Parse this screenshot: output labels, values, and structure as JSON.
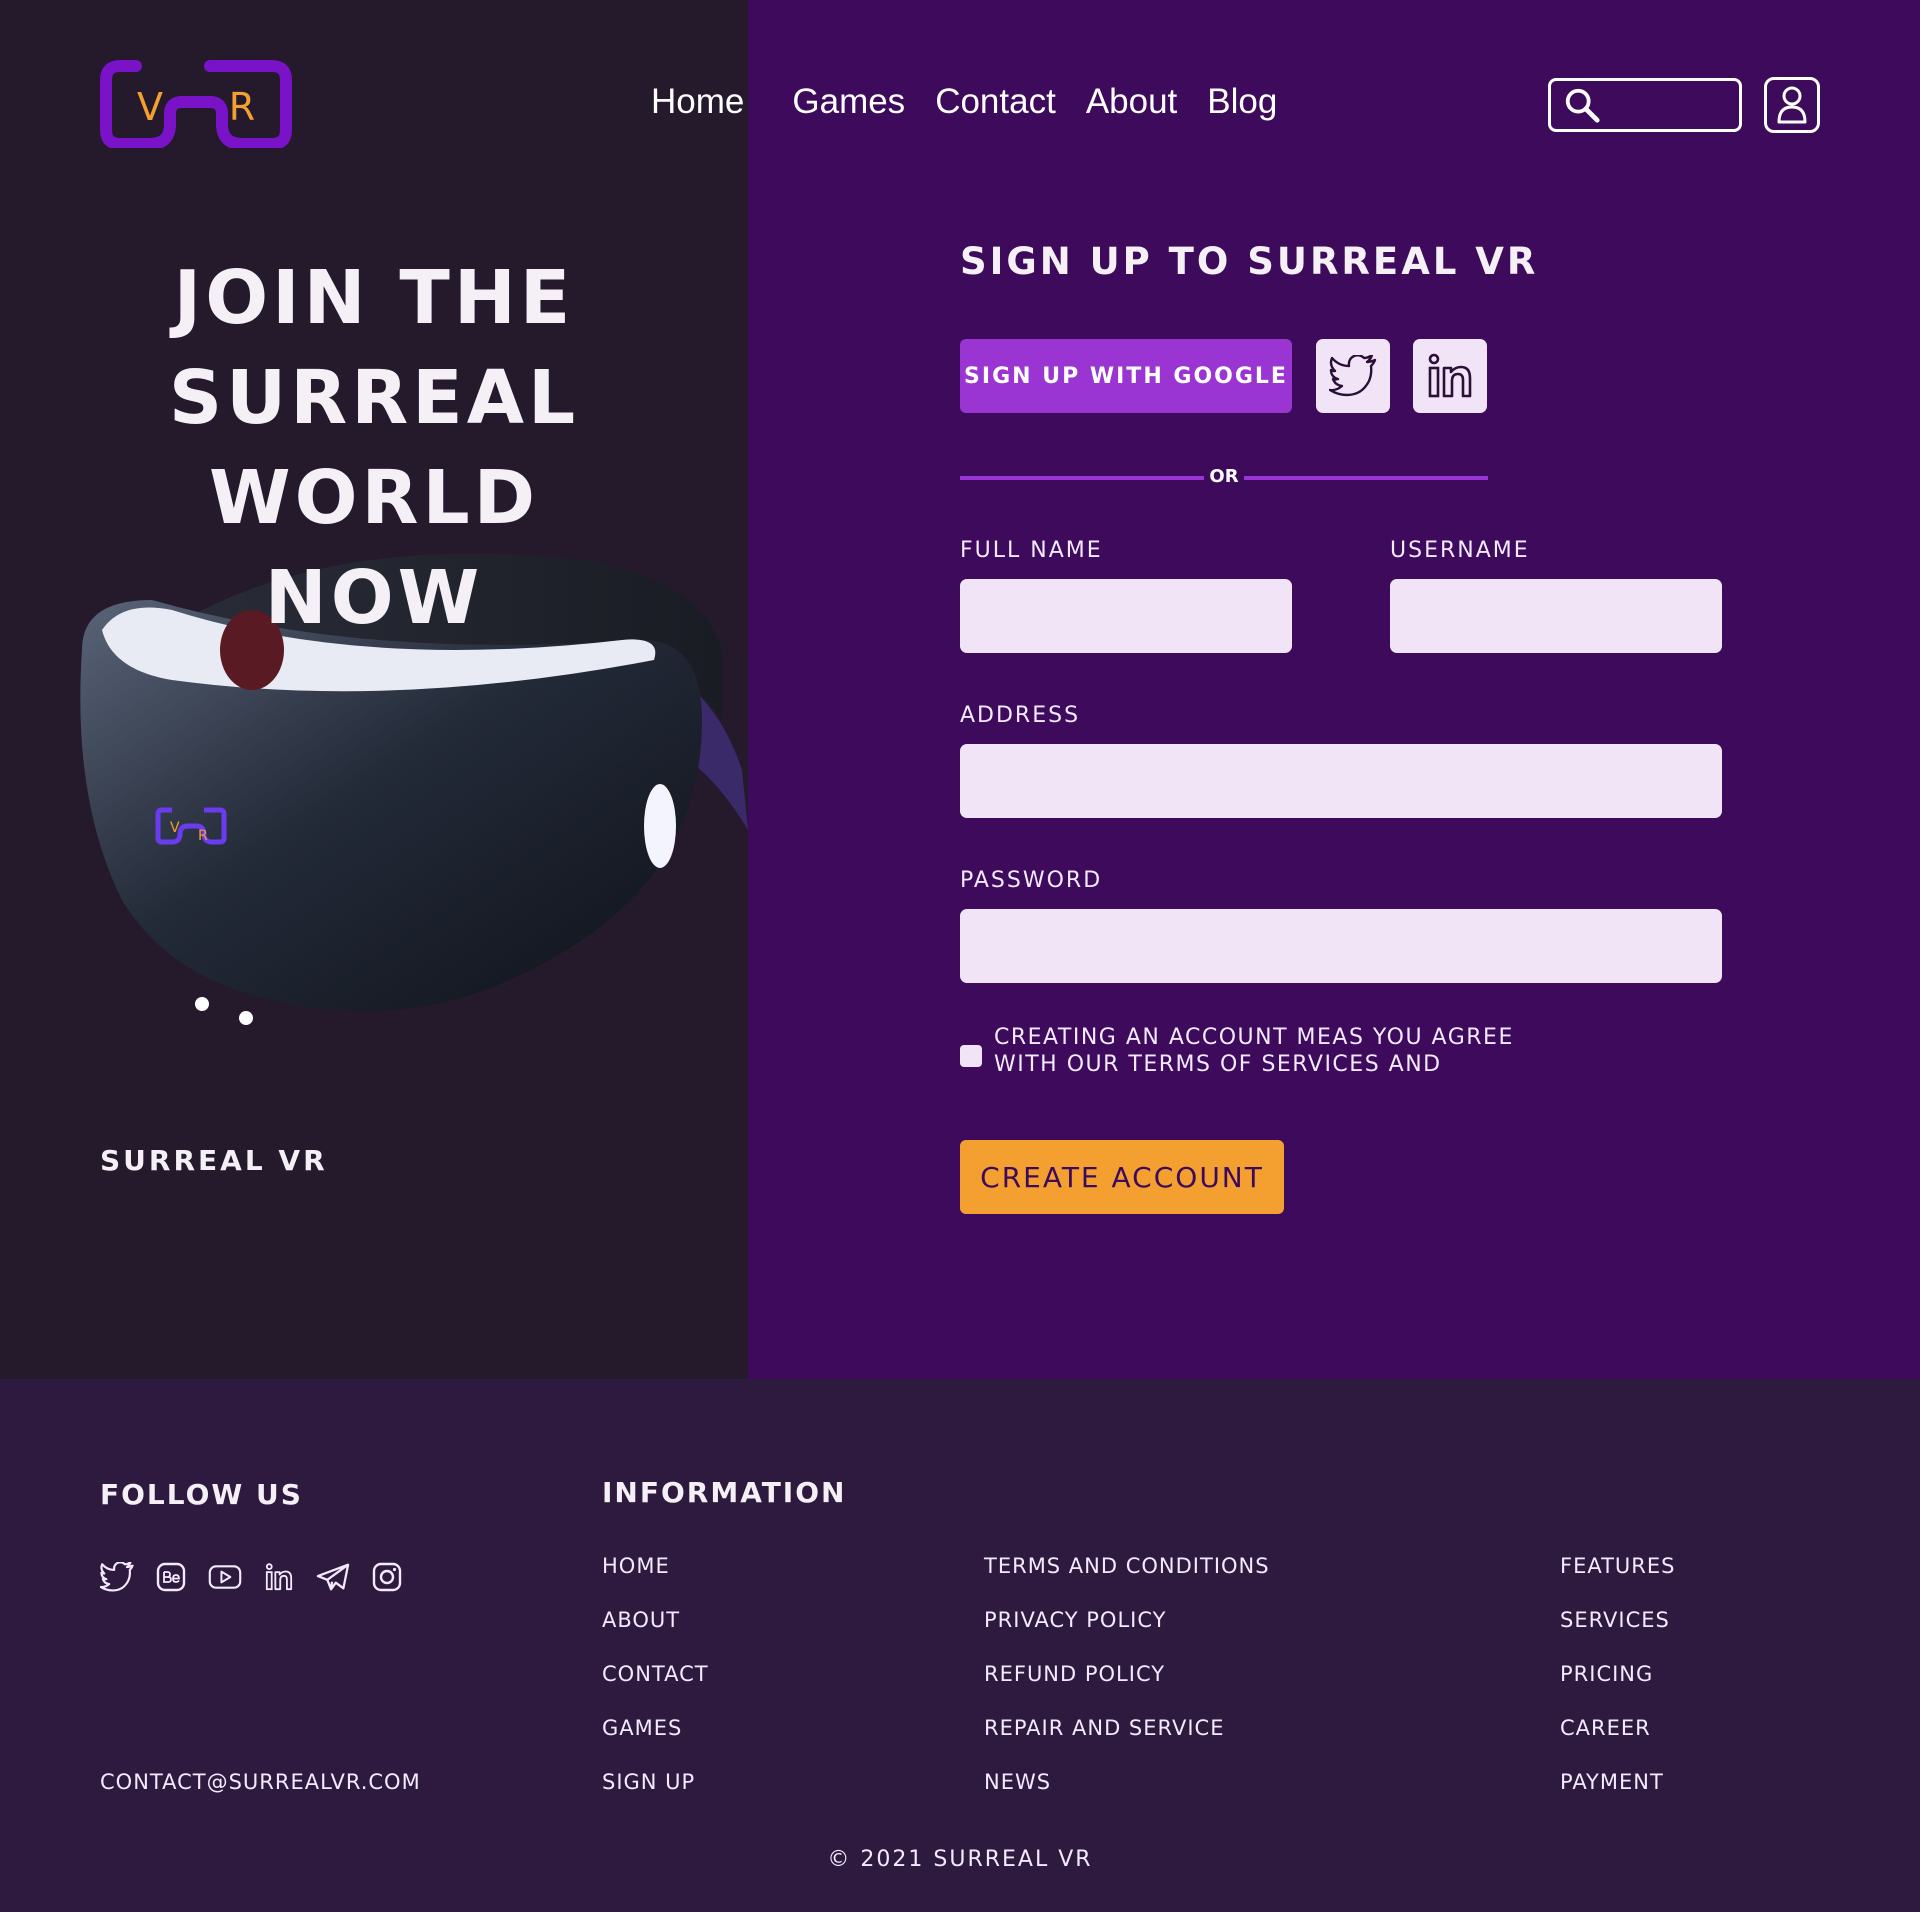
{
  "brand": {
    "logo_letters": [
      "V",
      "R"
    ],
    "name": "SURREAL VR",
    "colors": {
      "accent_orange": "#f4a030",
      "accent_purple": "#9a35d4",
      "logo_purple": "#7a12c8",
      "panel_dark": "#241a2c",
      "panel_purple": "#3d0a5c",
      "footer": "#2f1a3f",
      "input_bg": "#f2e4f7"
    }
  },
  "nav": {
    "items": [
      "Home",
      "Games",
      "Contact",
      "About",
      "Blog"
    ]
  },
  "search": {
    "icon": "search-icon",
    "value": ""
  },
  "user": {
    "icon": "user-icon"
  },
  "hero": {
    "title_lines": [
      "JOIN THE",
      "SURREAL",
      "WORLD",
      "NOW"
    ],
    "label": "SURREAL VR"
  },
  "form": {
    "title": "SIGN UP TO SURREAL VR",
    "google_label": "SIGN UP WITH GOOGLE",
    "social_icons": [
      "twitter-icon",
      "linkedin-icon"
    ],
    "or_label": "OR",
    "full_name_label": "FULL NAME",
    "username_label": "USERNAME",
    "address_label": "ADDRESS",
    "password_label": "PASSWORD",
    "full_name_value": "",
    "username_value": "",
    "address_value": "",
    "password_value": "",
    "terms_text": "CREATING AN ACCOUNT MEAS YOU AGREE WITH OUR TERMS OF SERVICES AND",
    "create_label": "CREATE ACCOUNT"
  },
  "footer": {
    "follow_heading": "FOLLOW US",
    "follow_icons": [
      "twitter-icon",
      "behance-icon",
      "youtube-icon",
      "linkedin-icon",
      "telegram-icon",
      "instagram-icon"
    ],
    "email": "CONTACT@SURREALVR.COM",
    "info_heading": "INFORMATION",
    "col1": [
      "HOME",
      "ABOUT",
      "CONTACT",
      "GAMES",
      "SIGN UP"
    ],
    "col2": [
      "TERMS AND CONDITIONS",
      "PRIVACY POLICY",
      "REFUND POLICY",
      "REPAIR AND SERVICE",
      "NEWS"
    ],
    "col3": [
      "FEATURES",
      "SERVICES",
      "PRICING",
      "CAREER",
      "PAYMENT"
    ],
    "copyright": "© 2021 SURREAL VR"
  }
}
